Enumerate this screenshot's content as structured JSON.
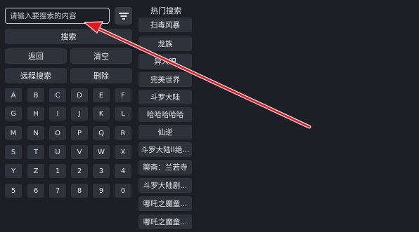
{
  "search": {
    "placeholder": "请输入要搜索的内容",
    "value": ""
  },
  "buttons": {
    "search": "搜索",
    "back": "返回",
    "clear": "清空",
    "remote_search": "远程搜索",
    "delete": "删除"
  },
  "keyboard": [
    [
      "A",
      "B",
      "C",
      "D",
      "E",
      "F"
    ],
    [
      "G",
      "H",
      "I",
      "J",
      "K",
      "L"
    ],
    [
      "M",
      "N",
      "O",
      "P",
      "Q",
      "R"
    ],
    [
      "S",
      "T",
      "U",
      "V",
      "W",
      "X"
    ],
    [
      "Y",
      "Z",
      "1",
      "2",
      "3",
      "4"
    ],
    [
      "5",
      "6",
      "7",
      "8",
      "9",
      "0"
    ]
  ],
  "hot": {
    "title": "热门搜索",
    "items": [
      "扫毒风暴",
      "龙族",
      "异人吧",
      "完美世界",
      "斗罗大陆",
      "哈哈哈哈哈",
      "仙逆",
      "斗罗大陆II绝...",
      "聊斋：兰若寺",
      "斗罗大陆剧...",
      "哪吒之魔童...",
      "哪吒之魔童..."
    ]
  },
  "icons": {
    "filter": "filter-icon"
  },
  "colors": {
    "background": "#1c1f26",
    "button": "#2e333b",
    "annotation_arrow": "#e8141c"
  }
}
